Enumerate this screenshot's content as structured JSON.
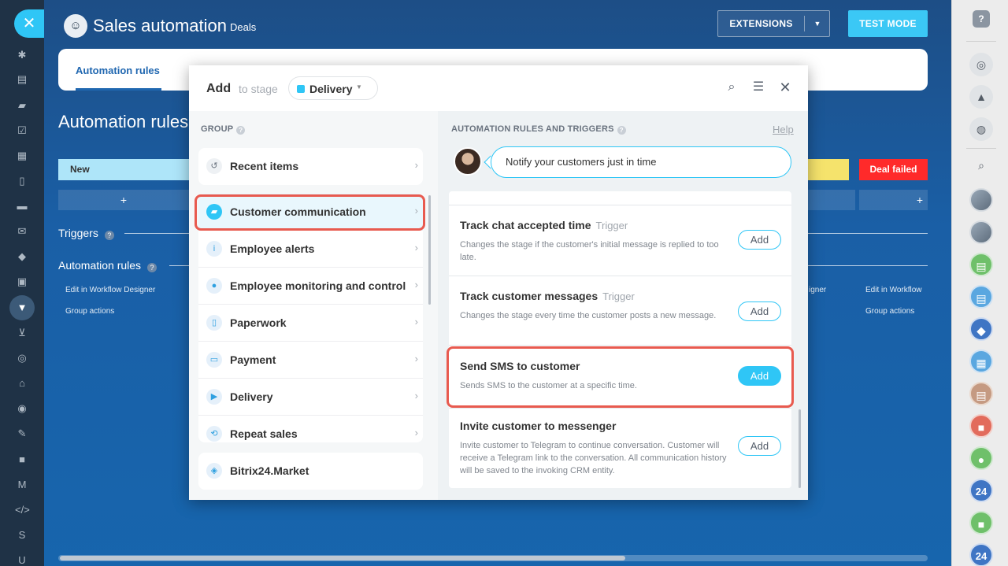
{
  "header": {
    "title": "Sales automation",
    "subtitle": "Deals",
    "extensions_label": "EXTENSIONS",
    "test_mode_label": "TEST MODE"
  },
  "tabs": {
    "active": "Automation rules"
  },
  "background": {
    "heading": "Automation rules",
    "stage_new": "New",
    "stage_failed": "Deal failed",
    "plus": "+",
    "triggers_label": "Triggers",
    "rules_label": "Automation rules",
    "edit_designer_left": "Edit in Workflow Designer",
    "group_actions_left": "Group actions",
    "edit_designer_right_partial": "igner",
    "edit_workflow_right": "Edit in Workflow",
    "group_actions_right": "Group actions"
  },
  "modal": {
    "add_label": "Add",
    "to_stage_label": "to stage",
    "stage_name": "Delivery",
    "group_heading": "GROUP",
    "rules_heading": "AUTOMATION RULES AND TRIGGERS",
    "help_label": "Help",
    "bubble_text": "Notify your customers just in time",
    "groups": [
      {
        "label": "Recent items",
        "icon": "history-icon"
      },
      {
        "label": "Customer communication",
        "icon": "chat-icon"
      },
      {
        "label": "Employee alerts",
        "icon": "info-icon"
      },
      {
        "label": "Employee monitoring and control",
        "icon": "people-icon"
      },
      {
        "label": "Paperwork",
        "icon": "document-icon"
      },
      {
        "label": "Payment",
        "icon": "wallet-icon"
      },
      {
        "label": "Delivery",
        "icon": "truck-icon"
      },
      {
        "label": "Repeat sales",
        "icon": "repeat-icon"
      }
    ],
    "market_label": "Bitrix24.Market",
    "rules": [
      {
        "title": "Track chat accepted time",
        "tag": "Trigger",
        "desc": "Changes the stage if the customer's initial message is replied to too late.",
        "add": "Add"
      },
      {
        "title": "Track customer messages",
        "tag": "Trigger",
        "desc": "Changes the stage every time the customer posts a new message.",
        "add": "Add"
      },
      {
        "title": "Send SMS to customer",
        "tag": "",
        "desc": "Sends SMS to the customer at a specific time.",
        "add": "Add"
      },
      {
        "title": "Invite customer to messenger",
        "tag": "",
        "desc": "Invite customer to Telegram to continue conversation. Customer will receive a Telegram link to the conversation. All communication history will be saved to the invoking CRM entity.",
        "add": "Add"
      }
    ]
  },
  "right_bar": {
    "help": "?",
    "badge_24": "24"
  },
  "left_bar": {
    "close": "✕",
    "letter_s": "S",
    "letter_u": "U"
  },
  "colors": {
    "accent": "#2fc6f6",
    "highlight": "#e85a4f",
    "danger": "#ff2a2a"
  }
}
